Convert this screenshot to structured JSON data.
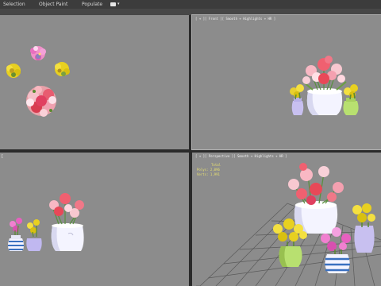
{
  "ribbon": {
    "tabs": [
      "Selection",
      "Object Paint",
      "Populate"
    ]
  },
  "viewports": {
    "top": {
      "label": ""
    },
    "front": {
      "label": "[ + ][ Front ][ Smooth + Highlights + HR ]"
    },
    "left": {
      "label": "["
    },
    "perspective": {
      "label": "[ + ][ Perspective ][ Smooth + Highlights + HR ]",
      "stats_title": "Total",
      "polys": "Polys: 2,096",
      "verts": "Verts: 1,991"
    }
  },
  "colors": {
    "viewport_bg": "#8c8c8c",
    "ribbon_bg": "#3c3c3c",
    "frame_bg": "#2b2b2b",
    "stats_text": "#e8e070"
  }
}
